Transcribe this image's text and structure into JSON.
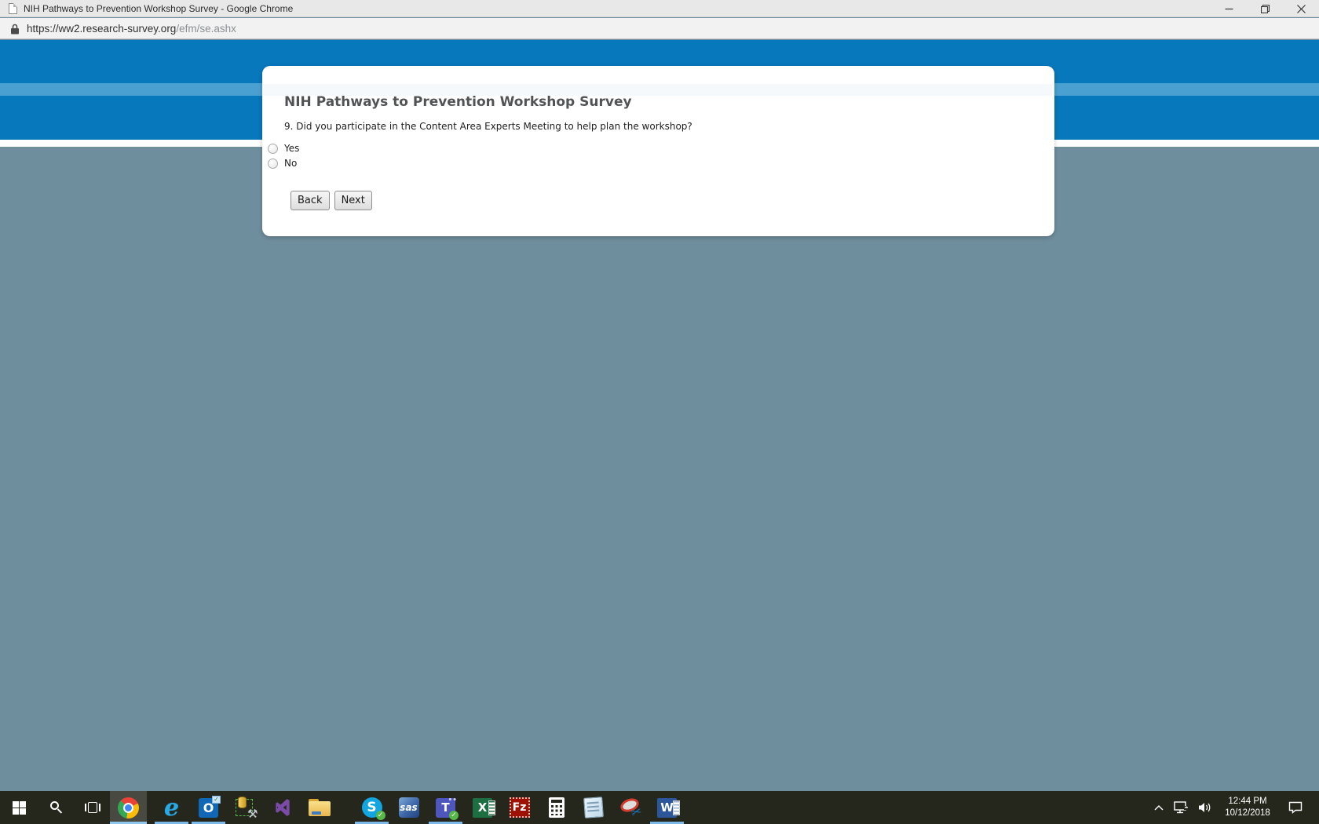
{
  "window": {
    "title": "NIH Pathways to Prevention Workshop Survey - Google Chrome"
  },
  "address_bar": {
    "url_domain": "https://ww2.research-survey.org",
    "url_path": "/efm/se.ashx"
  },
  "survey": {
    "title": "NIH Pathways to Prevention Workshop Survey",
    "question": "9. Did you participate in the Content Area Experts Meeting to help plan the workshop?",
    "options": [
      "Yes",
      "No"
    ],
    "options_selected": [
      false,
      false
    ],
    "buttons": {
      "back": "Back",
      "next": "Next"
    }
  },
  "taskbar": {
    "items": [
      "start",
      "search",
      "task-view",
      "chrome",
      "internet-explorer",
      "outlook",
      "admin-tools",
      "visual-studio",
      "file-explorer",
      "skype",
      "sas",
      "teams",
      "excel",
      "filezilla",
      "calculator",
      "notepad",
      "snipping-tool",
      "word"
    ],
    "active_app": "chrome",
    "running_apps": [
      "chrome",
      "internet-explorer",
      "outlook",
      "skype",
      "teams",
      "word"
    ],
    "glyphs": {
      "ie": "e",
      "outlook": "O",
      "outlook_check": "✓",
      "skype": "S",
      "skype_check": "✓",
      "sas": "sas",
      "teams": "T",
      "teams_people": "••",
      "teams_check": "✓",
      "excel": "X",
      "filezilla": "Fz",
      "word": "W",
      "admin_tools": "⚒",
      "snip_scissors": "✂"
    },
    "tray": {
      "time": "12:44 PM",
      "date": "10/12/2018"
    }
  },
  "colors": {
    "band_blue": "#0778BC",
    "band_light_blue": "#4AA0D0",
    "page_gray": "#6F8E9D",
    "card_strip": "#F5F9FC",
    "taskbar_bg": "#25271C",
    "taskbar_underline": "#7CB9E8",
    "titlebar_bg": "#E8E8E8"
  }
}
